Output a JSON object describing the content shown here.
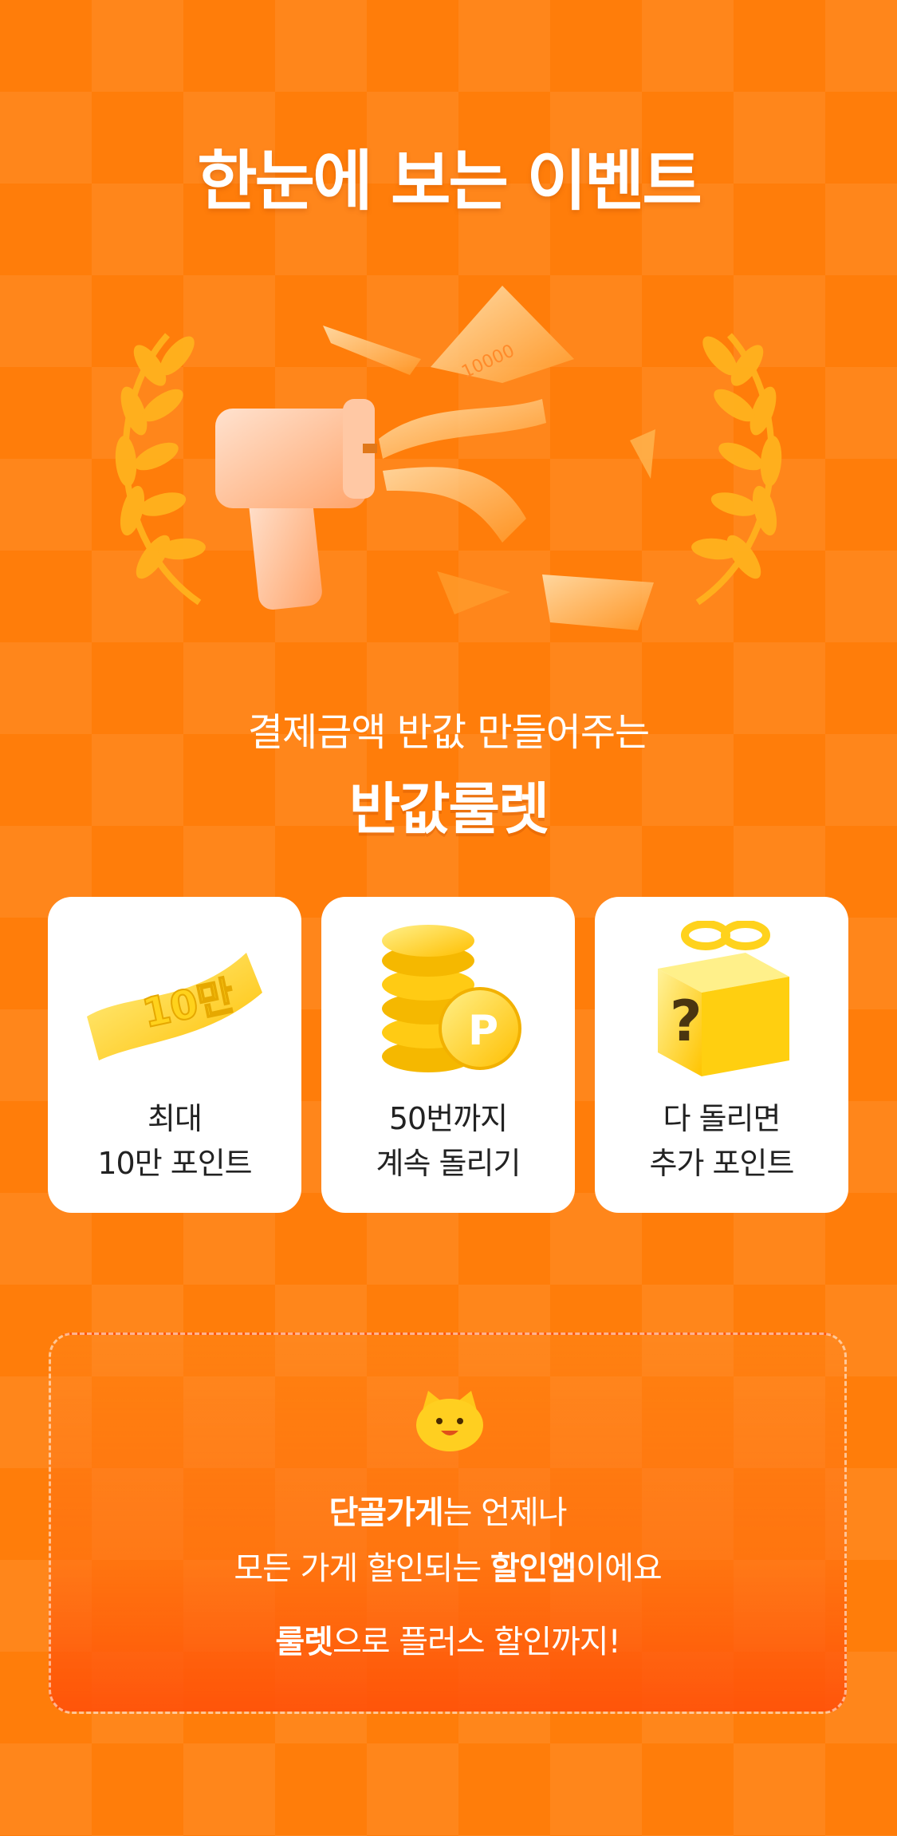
{
  "page": {
    "title": "한눈에 보는 이벤트"
  },
  "hero": {
    "subtitle": "결제금액 반값 만들어주는",
    "brand": "반값룰렛",
    "bill_label": "10000"
  },
  "cards": [
    {
      "icon": "10man-banner-icon",
      "badge": "10만",
      "line1": "최대",
      "line2": "10만 포인트"
    },
    {
      "icon": "coin-stack-icon",
      "badge": "P",
      "line1": "50번까지",
      "line2": "계속 돌리기"
    },
    {
      "icon": "gift-box-icon",
      "badge": "?",
      "line1": "다 돌리면",
      "line2": "추가 포인트"
    }
  ],
  "promo": {
    "line1_bold": "단골가게",
    "line1_rest": "는 언제나",
    "line2_start": "모든 가게 할인되는 ",
    "line2_bold": "할인앱",
    "line2_end": "이에요",
    "line3_bold": "룰렛",
    "line3_rest": "으로 플러스 할인까지!"
  },
  "colors": {
    "background": "#ff7d0a",
    "card": "#ffffff",
    "gold": "#ffc21a"
  }
}
